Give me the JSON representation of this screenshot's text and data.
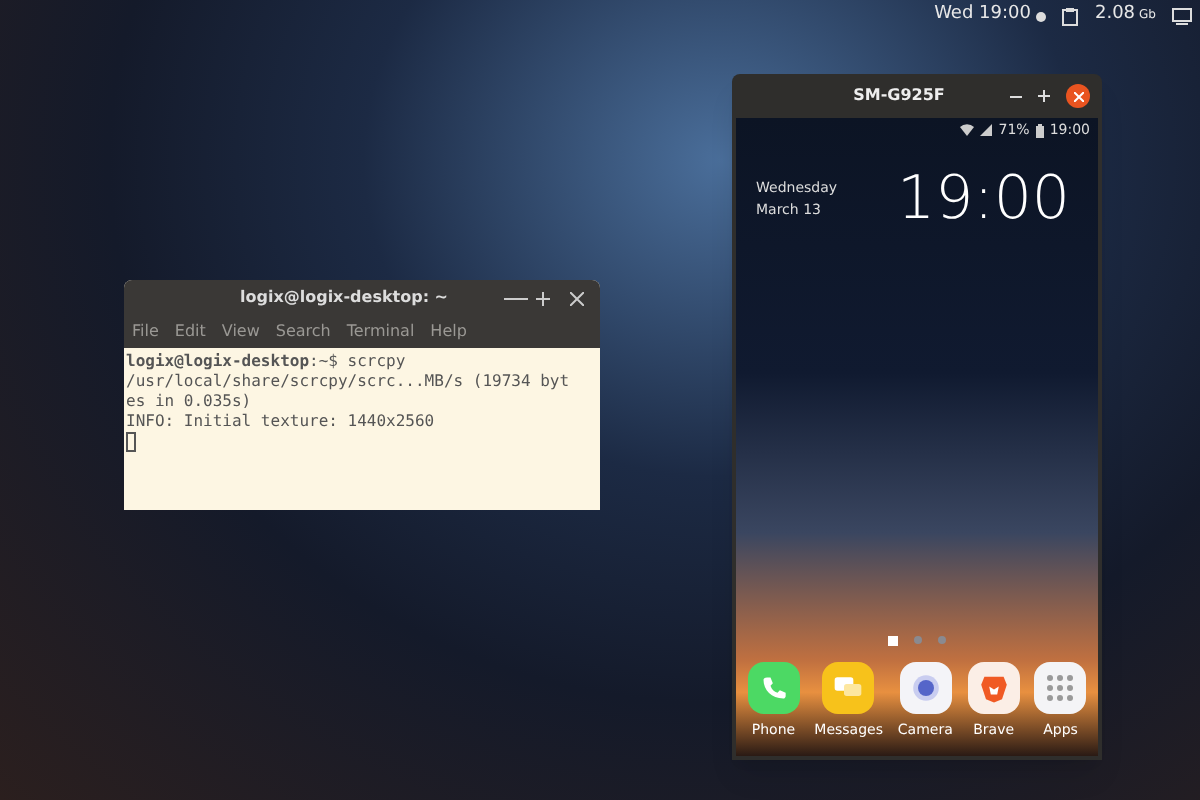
{
  "top_bar": {
    "clock": "Wed 19:00",
    "memory": "2.08",
    "memory_unit": "Gb"
  },
  "terminal": {
    "title": "logix@logix-desktop: ~",
    "menu": [
      "File",
      "Edit",
      "View",
      "Search",
      "Terminal",
      "Help"
    ],
    "lines": [
      "**logix@logix-desktop**:~$ scrcpy",
      "/usr/local/share/scrcpy/scrc...MB/s (19734 byt",
      "es in 0.035s)",
      "INFO: Initial texture: 1440x2560"
    ]
  },
  "phone_window": {
    "title": "SM-G925F",
    "battery": "71%",
    "status_time": "19:00",
    "day": "Wednesday",
    "date": "March 13",
    "clock": "19:00",
    "pages": [
      {
        "selected": true
      },
      {
        "selected": false
      },
      {
        "selected": false
      }
    ],
    "dock": [
      {
        "kind": "phone",
        "label": "Phone"
      },
      {
        "kind": "messages",
        "label": "Messages"
      },
      {
        "kind": "camera",
        "label": "Camera"
      },
      {
        "kind": "browser",
        "label": "Brave"
      },
      {
        "kind": "apps",
        "label": "Apps"
      }
    ]
  }
}
